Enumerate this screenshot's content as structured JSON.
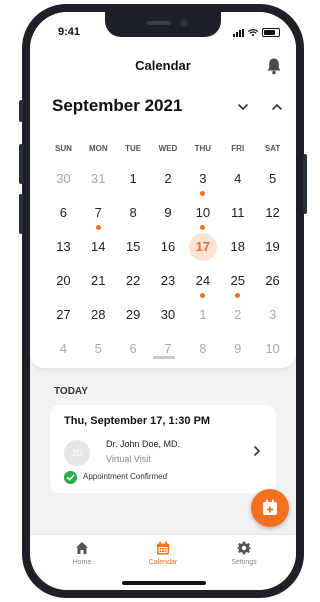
{
  "status_bar": {
    "time": "9:41"
  },
  "header": {
    "title": "Calendar"
  },
  "calendar": {
    "month_label": "September 2021",
    "weekdays": [
      "SUN",
      "MON",
      "TUE",
      "WED",
      "THU",
      "FRI",
      "SAT"
    ],
    "weeks": [
      [
        {
          "d": "30",
          "m": true
        },
        {
          "d": "31",
          "m": true
        },
        {
          "d": "1"
        },
        {
          "d": "2"
        },
        {
          "d": "3",
          "e": true
        },
        {
          "d": "4"
        },
        {
          "d": "5"
        }
      ],
      [
        {
          "d": "6"
        },
        {
          "d": "7",
          "e": true
        },
        {
          "d": "8"
        },
        {
          "d": "9"
        },
        {
          "d": "10",
          "e": true
        },
        {
          "d": "11"
        },
        {
          "d": "12"
        }
      ],
      [
        {
          "d": "13"
        },
        {
          "d": "14"
        },
        {
          "d": "15"
        },
        {
          "d": "16"
        },
        {
          "d": "17",
          "s": true
        },
        {
          "d": "18"
        },
        {
          "d": "19"
        }
      ],
      [
        {
          "d": "20"
        },
        {
          "d": "21"
        },
        {
          "d": "22"
        },
        {
          "d": "23"
        },
        {
          "d": "24",
          "e": true
        },
        {
          "d": "25",
          "e": true
        },
        {
          "d": "26"
        }
      ],
      [
        {
          "d": "27"
        },
        {
          "d": "28"
        },
        {
          "d": "29"
        },
        {
          "d": "30"
        },
        {
          "d": "1",
          "m": true
        },
        {
          "d": "2",
          "m": true
        },
        {
          "d": "3",
          "m": true
        }
      ],
      [
        {
          "d": "4",
          "m": true
        },
        {
          "d": "5",
          "m": true
        },
        {
          "d": "6",
          "m": true
        },
        {
          "d": "7",
          "m": true
        },
        {
          "d": "8",
          "m": true
        },
        {
          "d": "9",
          "m": true
        },
        {
          "d": "10",
          "m": true
        }
      ]
    ]
  },
  "today": {
    "section_label": "TODAY",
    "appointment": {
      "datetime": "Thu, September 17, 1:30 PM",
      "avatar_initials": "JD",
      "doctor": "Dr. John Doe, MD.",
      "visit_type": "Virtual Visit",
      "status": "Appointment Confirmed"
    }
  },
  "tabs": [
    {
      "label": "Home",
      "icon": "home-icon",
      "active": false
    },
    {
      "label": "Calendar",
      "icon": "calendar-icon",
      "active": true
    },
    {
      "label": "Settings",
      "icon": "gear-icon",
      "active": false
    }
  ],
  "colors": {
    "accent": "#f37021",
    "confirmed": "#2eaa4e",
    "selected_bg": "#fde3d5"
  }
}
